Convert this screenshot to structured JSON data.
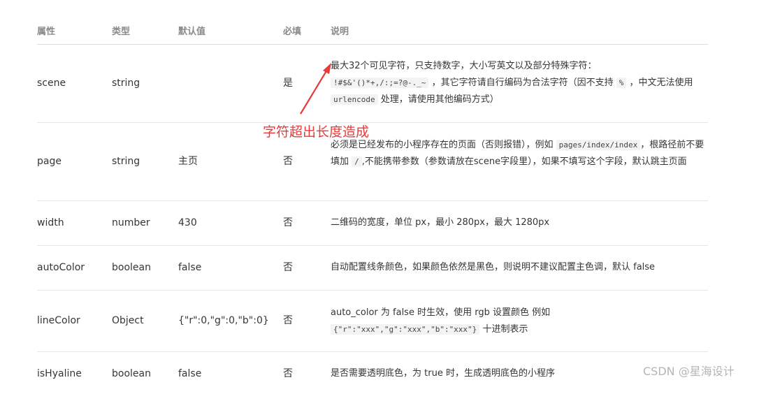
{
  "headers": {
    "name": "属性",
    "type": "类型",
    "default": "默认值",
    "required": "必填",
    "desc": "说明"
  },
  "rows": [
    {
      "name": "scene",
      "type": "string",
      "default": "",
      "required": "是",
      "desc_line1": "最大32个可见字符，只支持数字，大小写英文以及部分特殊字符：",
      "desc_code1": "!#$&'()*+,/:;=?@-._~",
      "desc_text2": "，其它字符请自行编码为合法字符（因不支持",
      "desc_code2": "%",
      "desc_text3": "，中文无法使用",
      "desc_code3": "urlencode",
      "desc_text4": "处理，请使用其他编码方式）"
    },
    {
      "name": "page",
      "type": "string",
      "default": "主页",
      "required": "否",
      "desc_text1": "必须是已经发布的小程序存在的页面（否则报错），例如",
      "desc_code1": "pages/index/index",
      "desc_text2": "，根路径前不要填加",
      "desc_code2": "/",
      "desc_text3": ",不能携带参数（参数请放在scene字段里），如果不填写这个字段，默认跳主页面"
    },
    {
      "name": "width",
      "type": "number",
      "default": "430",
      "required": "否",
      "desc": "二维码的宽度，单位 px，最小 280px，最大 1280px"
    },
    {
      "name": "autoColor",
      "type": "boolean",
      "default": "false",
      "required": "否",
      "desc": "自动配置线条颜色，如果颜色依然是黑色，则说明不建议配置主色调，默认 false"
    },
    {
      "name": "lineColor",
      "type": "Object",
      "default": "{\"r\":0,\"g\":0,\"b\":0}",
      "required": "否",
      "desc_text1": "auto_color 为 false 时生效，使用 rgb 设置颜色 例如",
      "desc_code1": "{\"r\":\"xxx\",\"g\":\"xxx\",\"b\":\"xxx\"}",
      "desc_text2": "十进制表示"
    },
    {
      "name": "isHyaline",
      "type": "boolean",
      "default": "false",
      "required": "否",
      "desc": "是否需要透明底色，为 true 时，生成透明底色的小程序"
    }
  ],
  "annotation": "字符超出长度造成",
  "annotation_color": "#e83a3a",
  "watermark": "CSDN @星海设计"
}
